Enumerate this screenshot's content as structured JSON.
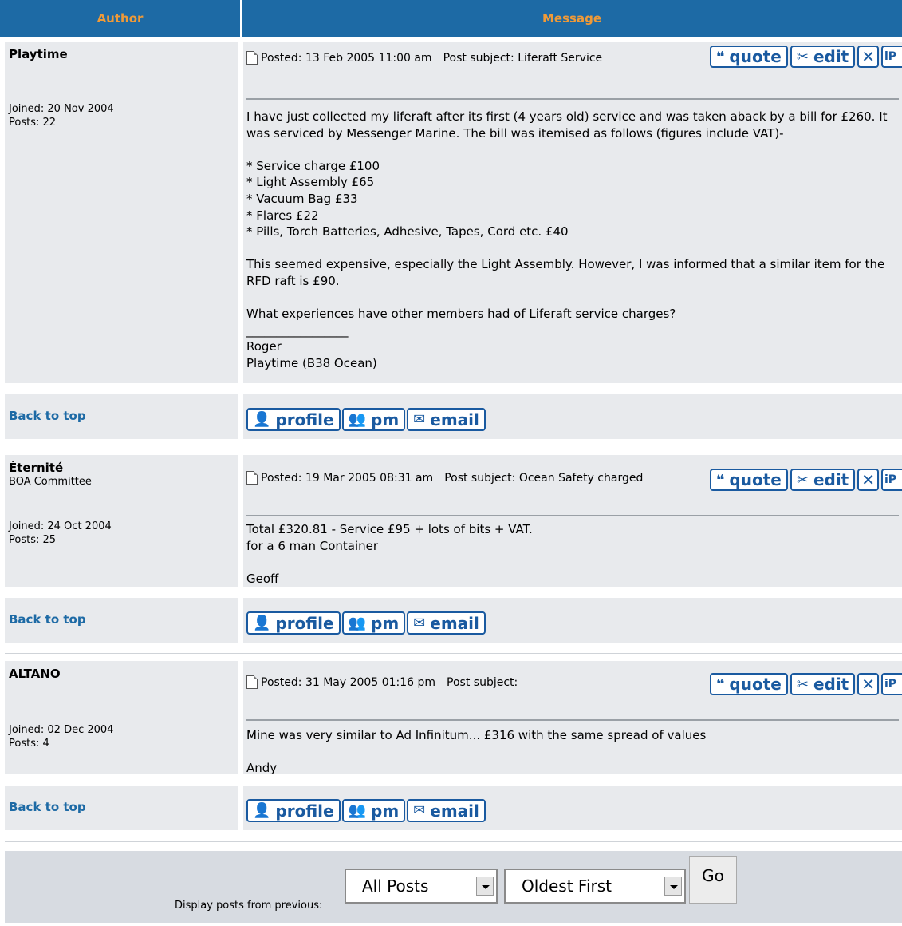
{
  "header": {
    "author": "Author",
    "message": "Message"
  },
  "posts": [
    {
      "author": "Playtime",
      "rank": "",
      "joined": "Joined: 20 Nov 2004",
      "posts": "Posts: 22",
      "posted": "Posted: 13 Feb 2005 11:00 am",
      "subject": "Post subject: Liferaft Service",
      "body": "I have just collected my liferaft after its first (4 years old) service and was taken aback by a bill for £260. It was serviced by Messenger Marine. The bill was itemised as follows (figures include VAT)-\n\n* Service charge £100\n* Light Assembly £65\n* Vacuum Bag £33\n* Flares £22\n* Pills, Torch Batteries, Adhesive, Tapes, Cord etc. £40\n\nThis seemed expensive, especially the Light Assembly. However, I was informed that a similar item for the RFD raft is £90.\n\nWhat experiences have other members had of Liferaft service charges?\n_________________\nRoger\nPlaytime (B38 Ocean)"
    },
    {
      "author": "Éternité",
      "rank": "BOA Committee",
      "joined": "Joined: 24 Oct 2004",
      "posts": "Posts: 25",
      "posted": "Posted: 19 Mar 2005 08:31 am",
      "subject": "Post subject: Ocean Safety charged",
      "body": "Total £320.81 - Service £95 + lots of bits + VAT.\nfor a 6 man Container\n\nGeoff"
    },
    {
      "author": "ALTANO",
      "rank": "",
      "joined": "Joined: 02 Dec 2004",
      "posts": "Posts: 4",
      "posted": "Posted: 31 May 2005 01:16 pm",
      "subject": "Post subject:",
      "body": "Mine was very similar to Ad Infinitum... £316 with the same spread of values\n\nAndy"
    }
  ],
  "buttons": {
    "quote": "quote",
    "edit": "edit",
    "delete": "✕",
    "ip": "iP",
    "profile": "profile",
    "pm": "pm",
    "email": "email",
    "back_to_top": "Back to top"
  },
  "icons": {
    "quote": "speech-bubble-icon",
    "edit": "scissors-pencil-icon",
    "profile": "user-icon",
    "pm": "users-icon",
    "email": "envelope-icon"
  },
  "footer": {
    "label": "Display posts from previous:",
    "days_select": "All Posts",
    "order_select": "Oldest First",
    "go": "Go"
  }
}
